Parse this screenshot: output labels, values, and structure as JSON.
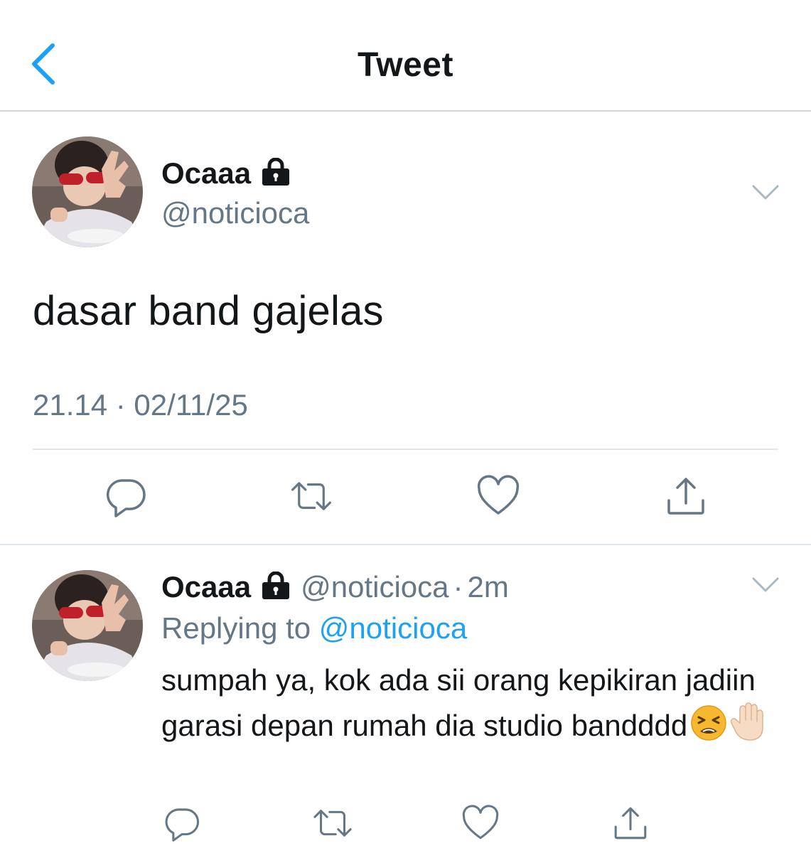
{
  "header": {
    "title": "Tweet"
  },
  "tweet": {
    "name": "Ocaaa",
    "handle": "@noticioca",
    "text": "dasar band gajelas",
    "timestamp": "21.14 · 02/11/25"
  },
  "reply": {
    "name": "Ocaaa",
    "handle": "@noticioca",
    "dot": "·",
    "time": "2m",
    "replying_prefix": "Replying to ",
    "replying_to": "@noticioca",
    "text": "sumpah ya, kok ada sii orang kepikiran jadiin garasi depan rumah dia studio bandddd",
    "emojis": [
      "tired-face-emoji",
      "raised-hand-emoji"
    ]
  },
  "icons": {
    "back": "chevron-left-icon",
    "more": "chevron-down-icon",
    "lock": "lock-icon",
    "reply": "reply-icon",
    "retweet": "retweet-icon",
    "like": "heart-icon",
    "share": "share-icon"
  },
  "colors": {
    "accent": "#1da1f2",
    "text": "#14171a",
    "secondary": "#657786",
    "divider": "#e1e8ed"
  }
}
